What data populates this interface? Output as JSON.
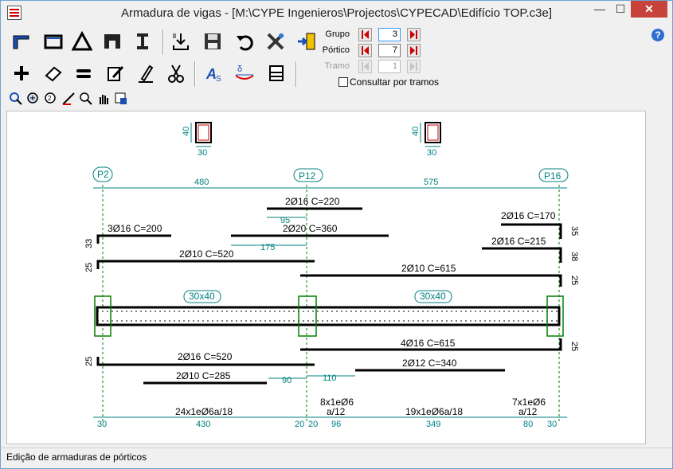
{
  "window": {
    "title": "Armadura de vigas - [M:\\CYPE Ingenieros\\Projectos\\CYPECAD\\Edifício TOP.c3e]",
    "min_glyph": "—",
    "max_glyph": "☐",
    "close_glyph": "✕"
  },
  "toolbar": {
    "row1_icons": [
      "beam-l-section-icon",
      "rectangle-section-icon",
      "triangle-icon",
      "t-section-icon",
      "i-beam-icon",
      "import-icon",
      "save-icon",
      "undo-icon",
      "tools-icon",
      "exit-door-icon"
    ],
    "row2_icons": [
      "add-icon",
      "eraser-icon",
      "equal-icon",
      "edit-icon",
      "pen-icon",
      "cut-icon",
      "text-style-icon",
      "deflection-icon",
      "printer-icon"
    ],
    "row3_icons": [
      "zoom-window-icon",
      "zoom-all-icon",
      "zoom-previous-icon",
      "measure-icon",
      "zoom-icon",
      "pan-icon",
      "view-settings-icon"
    ],
    "help_label": "?"
  },
  "navigator": {
    "grupo": {
      "label": "Grupo",
      "value": "3"
    },
    "portico": {
      "label": "Pórtico",
      "value": "7"
    },
    "tramo": {
      "label": "Tramo",
      "value": "1"
    },
    "consultar_label": "Consultar por tramos",
    "consultar_checked": false
  },
  "drawing": {
    "section_top": {
      "height": "40",
      "width": "30"
    },
    "section_top2": {
      "height": "40",
      "width": "30"
    },
    "columns": [
      "P2",
      "P12",
      "P16"
    ],
    "spans": [
      "480",
      "575"
    ],
    "top_bars": [
      {
        "label": "2Ø16 C=220"
      },
      {
        "label": "3Ø16 C=200"
      },
      {
        "label": "2Ø20 C=360"
      },
      {
        "label": "2Ø16 C=170"
      },
      {
        "label": "2Ø16 C=215"
      },
      {
        "label": "2Ø10 C=520"
      },
      {
        "label": "2Ø10 C=615"
      }
    ],
    "top_dims": {
      "d95": "95",
      "d175": "175"
    },
    "side_dims": {
      "left33": "33",
      "left25": "25",
      "right35": "35",
      "right38": "38",
      "right25": "25",
      "right25b": "25",
      "left25b": "25"
    },
    "beam_labels": [
      "30x40",
      "30x40"
    ],
    "bottom_bars": [
      {
        "label": "4Ø16 C=615"
      },
      {
        "label": "2Ø16 C=520"
      },
      {
        "label": "2Ø12 C=340"
      },
      {
        "label": "2Ø10 C=285"
      }
    ],
    "bottom_dims": {
      "d90": "90",
      "d110": "110"
    },
    "stirrups": [
      {
        "label": "24x1eØ6a/18"
      },
      {
        "label1": "8x1eØ6",
        "label2": "a/12"
      },
      {
        "label": "19x1eØ6a/18"
      },
      {
        "label1": "7x1eØ6",
        "label2": "a/12"
      }
    ],
    "stirrup_dims": [
      "30",
      "430",
      "20",
      "20",
      "96",
      "349",
      "80",
      "30"
    ]
  },
  "status": {
    "text": "Edição de armaduras de pórticos"
  }
}
